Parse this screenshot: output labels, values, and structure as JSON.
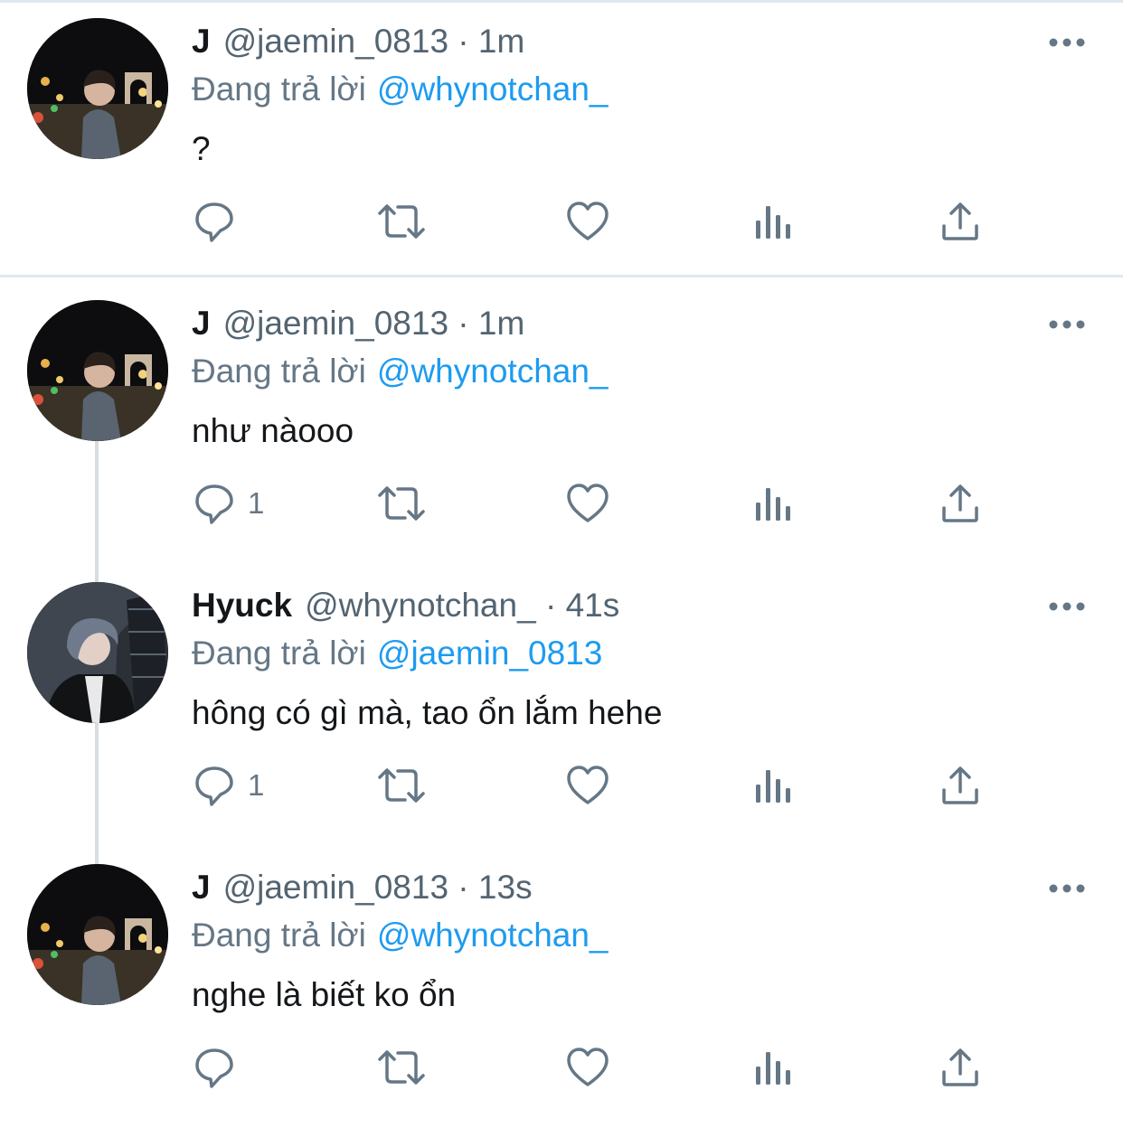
{
  "tweets": [
    {
      "name": "J",
      "handle": "@jaemin_0813",
      "time": "1m",
      "replying_label": "Đang trả lời",
      "replying_to": "@whynotchan_",
      "text": "?",
      "reply_count": "",
      "avatar": "photo-night-arc-de-triomphe"
    },
    {
      "name": "J",
      "handle": "@jaemin_0813",
      "time": "1m",
      "replying_label": "Đang trả lời",
      "replying_to": "@whynotchan_",
      "text": "như nàooo",
      "reply_count": "1",
      "avatar": "photo-night-arc-de-triomphe"
    },
    {
      "name": "Hyuck",
      "handle": "@whynotchan_",
      "time": "41s",
      "replying_label": "Đang trả lời",
      "replying_to": "@jaemin_0813",
      "text": "hông có gì mà, tao ổn lắm hehe",
      "reply_count": "1",
      "avatar": "photo-leather-jacket-night"
    },
    {
      "name": "J",
      "handle": "@jaemin_0813",
      "time": "13s",
      "replying_label": "Đang trả lời",
      "replying_to": "@whynotchan_",
      "text": "nghe là biết ko ổn",
      "reply_count": "",
      "avatar": "photo-night-arc-de-triomphe"
    }
  ],
  "icons": {
    "more": "more-dots-icon",
    "reply": "reply-icon",
    "retweet": "retweet-icon",
    "like": "like-icon",
    "views": "views-icon",
    "share": "share-icon"
  },
  "colors": {
    "accent": "#1d9bf0",
    "secondary_text": "#657786",
    "icon": "#657786",
    "divider": "#e1e8ed"
  }
}
